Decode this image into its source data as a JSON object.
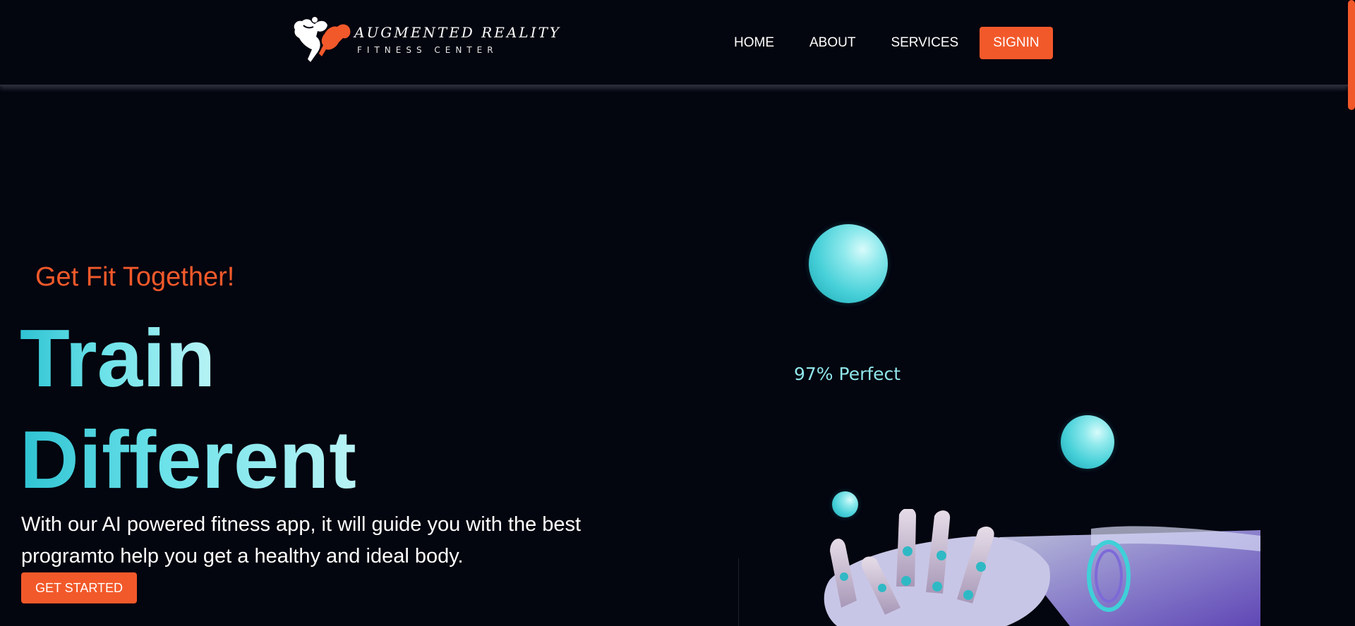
{
  "brand": {
    "title": "AUGMENTED REALITY",
    "subtitle": "FITNESS CENTER",
    "logo_icon": "flexing-bodybuilder-logo",
    "accent_color": "#f2592a"
  },
  "nav": {
    "home_label": "HOME",
    "about_label": "ABOUT",
    "services_label": "SERVICES",
    "signin_label": "SIGNIN"
  },
  "hero": {
    "tagline": "Get Fit Together!",
    "headline_line1": "Train",
    "headline_line2": "Different",
    "description": "With our AI powered fitness app, it will guide you with the best programto help you get a healthy and ideal body.",
    "cta_label": "GET STARTED",
    "headline_color": "#4fd6df"
  },
  "visual": {
    "accuracy_label": "97% Perfect",
    "image_icon": "robotic-hand-image"
  }
}
